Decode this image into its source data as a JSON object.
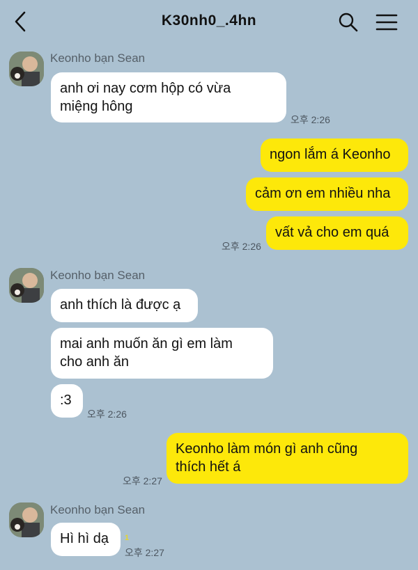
{
  "header": {
    "title": "K30nh0_.4hn",
    "back_icon": "chevron-left-icon",
    "search_icon": "search-icon",
    "menu_icon": "hamburger-menu-icon"
  },
  "colors": {
    "background": "#abc1d1",
    "outgoing_bubble": "#fde80a",
    "incoming_bubble": "#ffffff"
  },
  "messages": [
    {
      "sender": "Keonho bạn Sean",
      "bubbles": [
        "anh ơi nay cơm hộp có vừa\nmiệng hông"
      ],
      "time": "오후 2:26"
    },
    {
      "bubbles": [
        "ngon lắm á Keonho",
        "cảm ơn em nhiều nha",
        "vất vả cho em quá"
      ],
      "time": "오후 2:26"
    },
    {
      "sender": "Keonho bạn Sean",
      "bubbles": [
        "anh thích là được ạ",
        "mai anh muốn ăn gì em làm\ncho anh ăn",
        ":3"
      ],
      "time": "오후 2:26"
    },
    {
      "bubbles": [
        "Keonho làm món gì anh cũng\nthích hết á"
      ],
      "time": "오후 2:27"
    },
    {
      "sender": "Keonho bạn Sean",
      "bubbles": [
        "Hì hì dạ"
      ],
      "unread": "1",
      "time": "오후 2:27"
    }
  ]
}
